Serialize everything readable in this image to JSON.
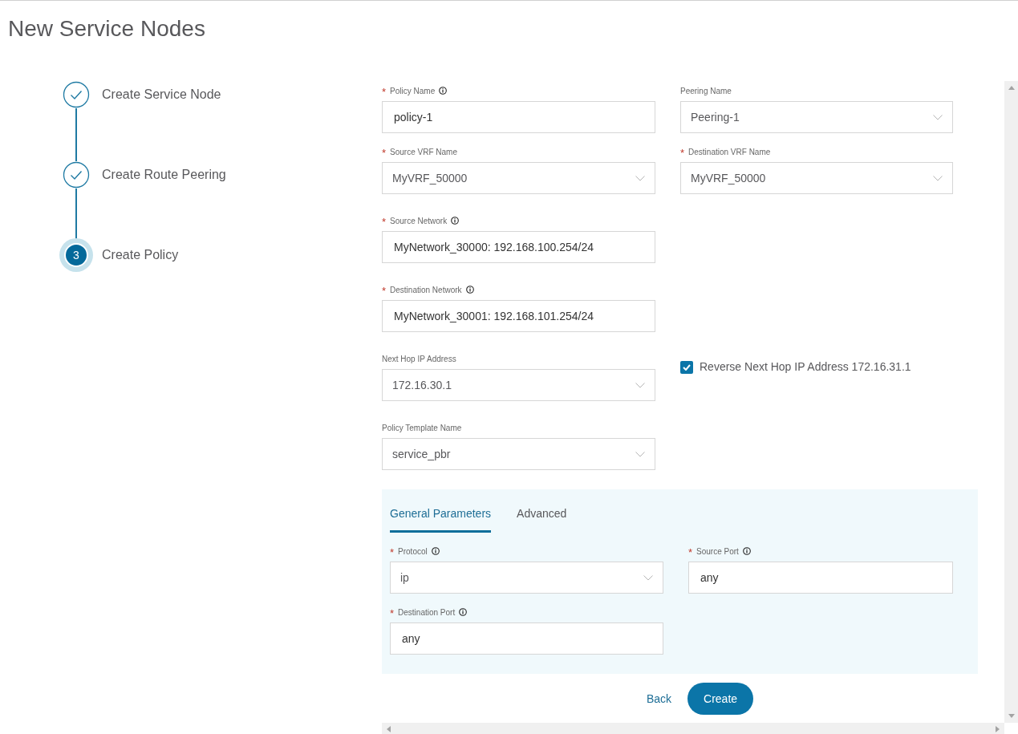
{
  "page": {
    "title": "New Service Nodes"
  },
  "steps": [
    {
      "label": "Create Service Node",
      "done": true
    },
    {
      "label": "Create Route Peering",
      "done": true
    },
    {
      "label": "Create Policy",
      "done": false,
      "number": "3"
    }
  ],
  "form": {
    "rows": [
      [
        {
          "kind": "text",
          "label": "Policy Name",
          "required_mark": "*",
          "info": true,
          "value": "policy-1"
        },
        {
          "kind": "select",
          "label": "Peering Name",
          "value": "Peering-1"
        }
      ],
      [
        {
          "kind": "select",
          "label": "Source VRF Name",
          "required_mark": "*",
          "value": "MyVRF_50000"
        },
        {
          "kind": "select",
          "label": "Destination VRF Name",
          "required_mark": "*",
          "value": "MyVRF_50000"
        }
      ],
      [
        {
          "kind": "text",
          "label": "Source Network",
          "required_mark": "*",
          "info": true,
          "value": "MyNetwork_30000: 192.168.100.254/24"
        }
      ],
      [
        {
          "kind": "text",
          "label": "Destination Network",
          "required_mark": "*",
          "info": true,
          "value": "MyNetwork_30001: 192.168.101.254/24"
        }
      ],
      [
        {
          "kind": "select",
          "label": "Next Hop IP Address",
          "value": "172.16.30.1"
        },
        {
          "kind": "checkbox",
          "label": "Reverse Next Hop IP Address 172.16.31.1",
          "checked": true
        }
      ],
      [
        {
          "kind": "select",
          "label": "Policy Template Name",
          "value": "service_pbr"
        }
      ]
    ]
  },
  "parameters": {
    "tabs": [
      {
        "label": "General Parameters",
        "selected": true
      },
      {
        "label": "Advanced",
        "selected": false
      }
    ],
    "rows": [
      [
        {
          "kind": "select",
          "label": "Protocol",
          "required_mark": "*",
          "info": true,
          "value": "ip"
        },
        {
          "kind": "text",
          "label": "Source Port",
          "required_mark": "*",
          "info": true,
          "value": "any"
        }
      ],
      [
        {
          "kind": "text",
          "label": "Destination Port",
          "required_mark": "*",
          "info": true,
          "value": "any"
        }
      ]
    ]
  },
  "buttons": [
    {
      "label": "Back",
      "kind": "link"
    },
    {
      "label": "Create",
      "kind": "primary"
    }
  ]
}
